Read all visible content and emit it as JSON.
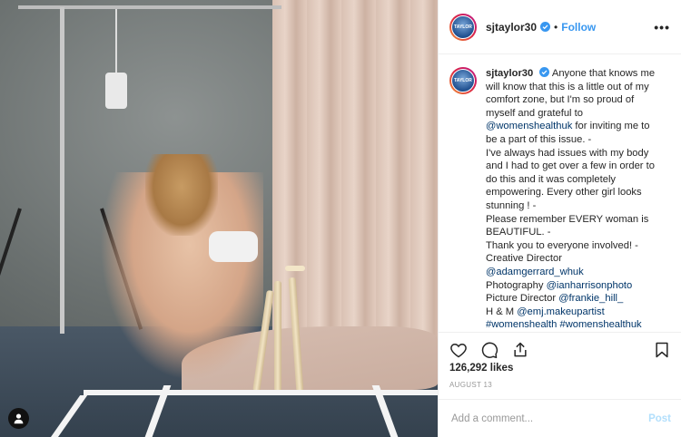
{
  "post": {
    "username": "sjtaylor30",
    "avatar_text": "TAYLOR",
    "follow_label": "Follow",
    "separator": "•",
    "more_label": "•••"
  },
  "caption": {
    "lines": [
      "Anyone that knows me will know that this is a little out of my comfort zone, but I'm so proud of myself and grateful to",
      "@womenshealthuk",
      "for inviting me to be a part of this issue. -",
      "I've always had issues with my body and I had to get over a few in order to do this and it was completely empowering. Every other girl looks stunning ! -",
      "Please remember EVERY woman is BEAUTIFUL. -",
      "Thank you to everyone involved! -",
      "Creative Director",
      "@adamgerrard_whuk",
      "Photography",
      "@ianharrisonphoto",
      "Picture Director",
      "@frankie_hill_",
      "H & M",
      "@emj.makeupartist",
      "#womenshealth #womenshealthuk"
    ]
  },
  "actions": {
    "icons": [
      "heart-icon",
      "comment-icon",
      "share-icon",
      "bookmark-icon"
    ]
  },
  "likes_text": "126,292 likes",
  "date_text": "AUGUST 13",
  "comment": {
    "placeholder": "Add a comment...",
    "post_label": "Post"
  },
  "colors": {
    "link_blue": "#3897f0",
    "mention": "#003569",
    "muted": "#999999",
    "post_disabled": "#b2dffc"
  }
}
